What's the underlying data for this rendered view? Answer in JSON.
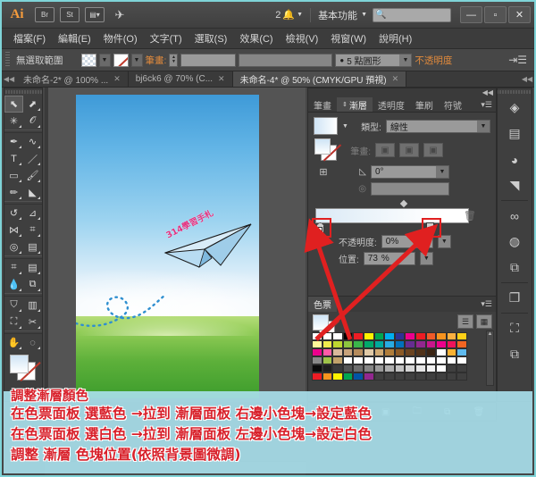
{
  "app": {
    "logo": "Ai",
    "title_icons": [
      "bridge-icon",
      "stock-icon",
      "arrange-documents-icon",
      "behance-icon"
    ],
    "bridge_label": "Br",
    "stock_label": "St",
    "notification_count": "2",
    "workspace": "基本功能",
    "search_placeholder": "",
    "window_buttons": {
      "minimize": "—",
      "maximize": "▫",
      "close": "✕"
    }
  },
  "menu": {
    "items": [
      {
        "label": "檔案(F)"
      },
      {
        "label": "編輯(E)"
      },
      {
        "label": "物件(O)"
      },
      {
        "label": "文字(T)"
      },
      {
        "label": "選取(S)"
      },
      {
        "label": "效果(C)"
      },
      {
        "label": "檢視(V)"
      },
      {
        "label": "視窗(W)"
      },
      {
        "label": "說明(H)"
      }
    ]
  },
  "control_bar": {
    "selection_label": "無選取範圍",
    "fill_swatch": "gradient-light-blue",
    "stroke_swatch": "none",
    "stroke_label": "筆畫:",
    "stroke_weight": "",
    "profile": "",
    "brush_definition": "5 點圓形",
    "opacity_label": "不透明度"
  },
  "doc_tabs": [
    {
      "label": "未命名-2* @ 100% ...",
      "active": false,
      "close": "✕"
    },
    {
      "label": "bj6ck6 @ 70% (C...",
      "active": false,
      "close": "✕"
    },
    {
      "label": "未命名-4* @ 50% (CMYK/GPU 預視)",
      "active": true,
      "close": "✕"
    }
  ],
  "toolbar": {
    "tools": [
      {
        "name": "selection-tool",
        "glyph": "⬉",
        "selected": true
      },
      {
        "name": "direct-selection-tool",
        "glyph": "⬈",
        "selected": false
      },
      {
        "name": "magic-wand-tool",
        "glyph": "✳",
        "selected": false
      },
      {
        "name": "lasso-tool",
        "glyph": "𝒪",
        "selected": false
      },
      {
        "name": "pen-tool",
        "glyph": "✒",
        "selected": false
      },
      {
        "name": "curvature-tool",
        "glyph": "∿",
        "selected": false
      },
      {
        "name": "type-tool",
        "glyph": "T",
        "selected": false
      },
      {
        "name": "line-segment-tool",
        "glyph": "／",
        "selected": false
      },
      {
        "name": "rectangle-tool",
        "glyph": "▭",
        "selected": false
      },
      {
        "name": "paintbrush-tool",
        "glyph": "🖌",
        "selected": false
      },
      {
        "name": "pencil-tool",
        "glyph": "✏",
        "selected": false
      },
      {
        "name": "shaper-tool",
        "glyph": "◣",
        "selected": false
      },
      {
        "name": "rotate-tool",
        "glyph": "↺",
        "selected": false
      },
      {
        "name": "scale-tool",
        "glyph": "⊿",
        "selected": false
      },
      {
        "name": "width-tool",
        "glyph": "⋈",
        "selected": false
      },
      {
        "name": "free-transform-tool",
        "glyph": "⌗",
        "selected": false
      },
      {
        "name": "shape-builder-tool",
        "glyph": "◎",
        "selected": false
      },
      {
        "name": "perspective-grid-tool",
        "glyph": "▤",
        "selected": false
      },
      {
        "name": "mesh-tool",
        "glyph": "⌗",
        "selected": false
      },
      {
        "name": "gradient-tool",
        "glyph": "▤",
        "selected": false
      },
      {
        "name": "eyedropper-tool",
        "glyph": "💧",
        "selected": false
      },
      {
        "name": "blend-tool",
        "glyph": "⧉",
        "selected": false
      },
      {
        "name": "symbol-sprayer-tool",
        "glyph": "⛉",
        "selected": false
      },
      {
        "name": "column-graph-tool",
        "glyph": "▥",
        "selected": false
      },
      {
        "name": "artboard-tool",
        "glyph": "⛶",
        "selected": false
      },
      {
        "name": "slice-tool",
        "glyph": "✂",
        "selected": false
      },
      {
        "name": "hand-tool",
        "glyph": "✋",
        "selected": false
      },
      {
        "name": "zoom-tool",
        "glyph": "◌",
        "selected": false
      }
    ]
  },
  "canvas": {
    "artwork_text": "314學習手札",
    "sky_top_color": "#3e9ad8",
    "grass_color": "#5db03a",
    "plane_color": "#b8dcf2",
    "path_color": "#2f8fd0"
  },
  "gradient_panel": {
    "tabs": [
      {
        "label": "筆畫",
        "active": false
      },
      {
        "label": "漸層",
        "active": true
      },
      {
        "label": "透明度",
        "active": false
      },
      {
        "label": "筆刷",
        "active": false
      },
      {
        "label": "符號",
        "active": false
      }
    ],
    "type_label": "類型:",
    "type_value": "線性",
    "stroke_label": "筆畫:",
    "angle_label": "angle-icon",
    "angle_value": "0°",
    "aspect_value": "",
    "opacity_label": "不透明度:",
    "opacity_value": "0%",
    "location_label": "位置:",
    "location_value": "73",
    "location_unit": "%",
    "stops": [
      {
        "name": "gradient-stop-left",
        "position_pct": 0,
        "color": "#ffffff"
      },
      {
        "name": "gradient-stop-right",
        "position_pct": 73,
        "color": "#ffffff"
      }
    ],
    "midpoint_pct": 55
  },
  "swatches_panel": {
    "tab_label": "色票",
    "rows": [
      [
        "#ffffff",
        "#ffffff",
        "#ffffff",
        "#000000",
        "#ed1c24",
        "#fff200",
        "#00a651",
        "#00aeef",
        "#2e3192",
        "#ec008c",
        "#ed1c24",
        "#f05a28",
        "#f7931e",
        "#fbb040",
        "#fdd017"
      ],
      [
        "#fff799",
        "#eeea4d",
        "#bdd630",
        "#8dc63f",
        "#39b54a",
        "#00a86b",
        "#00a99d",
        "#29abe2",
        "#0072bc",
        "#662d91",
        "#92278f",
        "#c7168c",
        "#ec008c",
        "#ed145b",
        "#f26522"
      ],
      [
        "#ec008c",
        "#ff5ba7",
        "#d9b99b",
        "#c8a27a",
        "#b58b5c",
        "#e0c9a6",
        "#cfa972",
        "#b07d3a",
        "#8c5a25",
        "#6b4420",
        "#51331a",
        "#3b2514",
        "#ffffff",
        "#f9b233",
        "#5fbbef"
      ],
      [
        "#8a8a8a",
        "#9fc34a",
        "#c2a26b",
        "#ffffff",
        "#ffffff",
        "#ffffff",
        "#ffffff",
        "#ffffff",
        "#ffffff",
        "#ffffff",
        "#ffffff",
        "#ffffff",
        "#ffffff",
        "#ffffff",
        "#ffffff"
      ],
      [
        "#0a0a0a",
        "#1f1f1f",
        "#3a3a3a",
        "#555555",
        "#6e6e6e",
        "#858585",
        "#9b9b9b",
        "#b0b0b0",
        "#c4c4c4",
        "#d6d6d6",
        "#e6e6e6",
        "#f2f2f2",
        "#ffffff",
        "#3f3f3f",
        "#3f3f3f"
      ],
      [
        "#ed1c24",
        "#f7941e",
        "#fff200",
        "#00a651",
        "#0054a6",
        "#92278f",
        "#3f3f3f",
        "#3f3f3f",
        "#3f3f3f",
        "#3f3f3f",
        "#3f3f3f",
        "#3f3f3f",
        "#3f3f3f",
        "#3f3f3f",
        "#3f3f3f"
      ]
    ]
  },
  "right_rail": {
    "icons": [
      {
        "name": "layers-icon",
        "glyph": "◈"
      },
      {
        "name": "align-icon",
        "glyph": "▤"
      },
      {
        "name": "color-palette-icon",
        "glyph": "🎨"
      },
      {
        "name": "gradient-panel-icon",
        "glyph": "◤"
      },
      {
        "name": "libraries-icon",
        "glyph": "∞"
      },
      {
        "name": "transparency-icon",
        "glyph": "◍"
      },
      {
        "name": "pathfinder-icon",
        "glyph": "⧉"
      },
      {
        "name": "transform-icon",
        "glyph": "⧉"
      },
      {
        "name": "artboards-icon",
        "glyph": "⛶"
      },
      {
        "name": "appearance-icon",
        "glyph": "❐"
      }
    ]
  },
  "annotations": {
    "lines": [
      "調整漸層顏色",
      "在色票面板 選藍色 →拉到 漸層面板 右邊小色塊→設定藍色",
      "在色票面板 選白色 →拉到 漸層面板 左邊小色塊→設定白色",
      "調整 漸層 色塊位置(依照背景圖微調)"
    ],
    "text_color": "#d8202a",
    "band_color": "#a8deea",
    "highlight_color": "#e02020"
  }
}
